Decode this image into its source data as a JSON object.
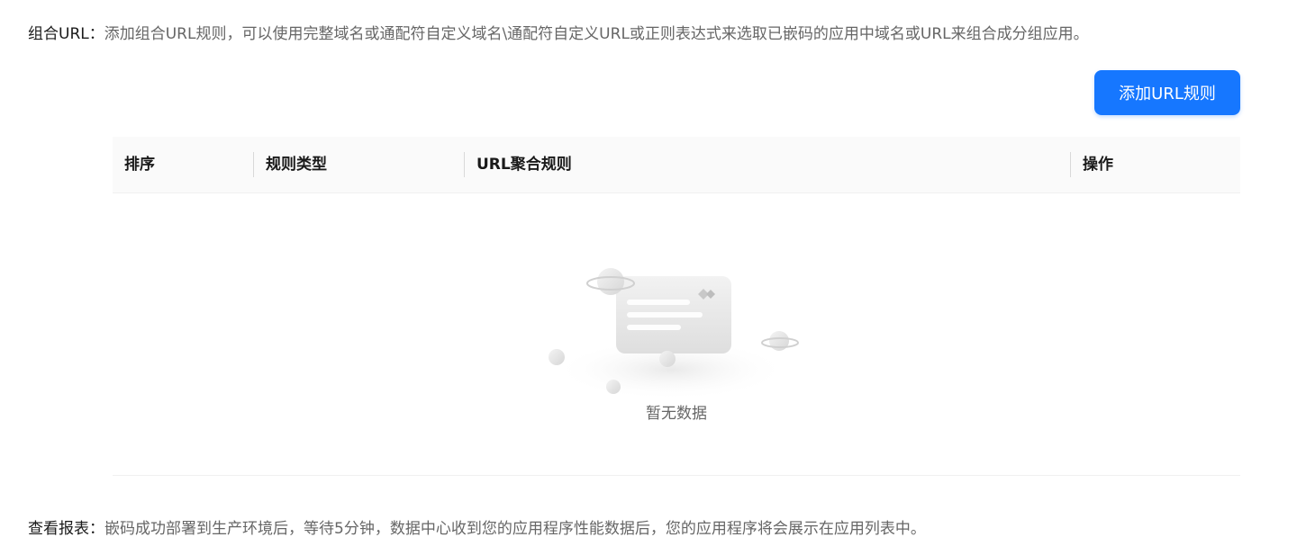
{
  "combine_url": {
    "label": "组合URL：",
    "description": "添加组合URL规则，可以使用完整域名或通配符自定义域名\\通配符自定义URL或正则表达式来选取已嵌码的应用中域名或URL来组合成分组应用。"
  },
  "toolbar": {
    "add_button_label": "添加URL规则"
  },
  "table": {
    "columns": [
      {
        "label": "排序"
      },
      {
        "label": "规则类型"
      },
      {
        "label": "URL聚合规则"
      },
      {
        "label": "操作"
      }
    ],
    "rows": [],
    "empty_text": "暂无数据"
  },
  "report": {
    "label": "查看报表：",
    "description": "嵌码成功部署到生产环境后，等待5分钟，数据中心收到您的应用程序性能数据后，您的应用程序将会展示在应用列表中。"
  },
  "colors": {
    "primary": "#1677ff",
    "header_bg": "#fafafa",
    "border": "#f0f0f0"
  }
}
